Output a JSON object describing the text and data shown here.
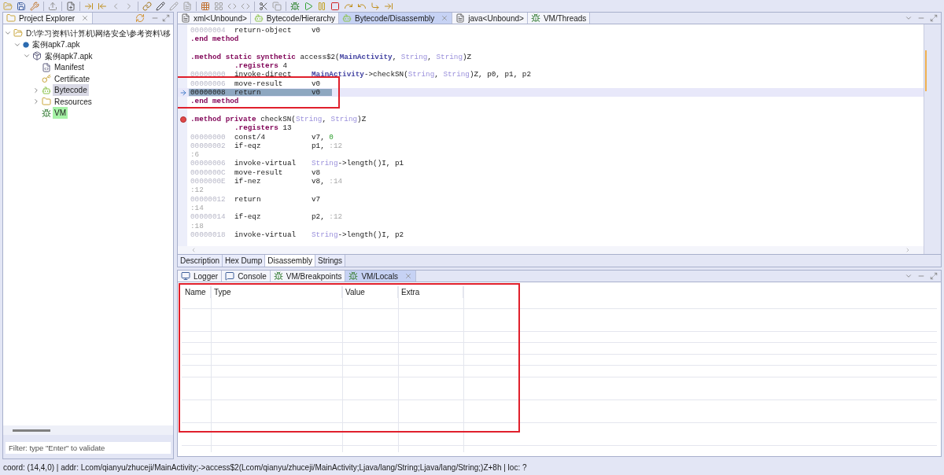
{
  "explorer": {
    "title": "Project Explorer",
    "tree": [
      {
        "kind": "folder",
        "label": "D:\\学习资料\\计算机\\网络安全\\参考资料\\移",
        "expanded": true,
        "selected": false,
        "highlighted": false,
        "children": [
          {
            "kind": "apk",
            "label": "案例apk7.apk",
            "expanded": true,
            "selected": false,
            "highlighted": false,
            "children": [
              {
                "kind": "package",
                "label": "案例apk7.apk",
                "expanded": true,
                "selected": false,
                "highlighted": false,
                "children": [
                  {
                    "kind": "manifest",
                    "label": "Manifest",
                    "selected": false,
                    "highlighted": false
                  },
                  {
                    "kind": "certificate",
                    "label": "Certificate",
                    "selected": false,
                    "highlighted": false
                  },
                  {
                    "kind": "bytecode",
                    "label": "Bytecode",
                    "expanded": false,
                    "selected": true,
                    "highlighted": false
                  },
                  {
                    "kind": "resources",
                    "label": "Resources",
                    "expanded": false,
                    "selected": false,
                    "highlighted": false
                  },
                  {
                    "kind": "vm",
                    "label": "VM",
                    "selected": false,
                    "highlighted": true
                  }
                ]
              }
            ]
          }
        ]
      }
    ],
    "filter": {
      "placeholder": "Filter: type \"Enter\" to validate"
    }
  },
  "editor": {
    "tabs": [
      {
        "kind": "xml",
        "label": "xml<Unbound>",
        "selected": false,
        "closable": false
      },
      {
        "kind": "bytecode",
        "label": "Bytecode/Hierarchy",
        "selected": false,
        "closable": false
      },
      {
        "kind": "bytecode",
        "label": "Bytecode/Disassembly",
        "selected": true,
        "closable": true
      },
      {
        "kind": "java",
        "label": "java<Unbound>",
        "selected": false,
        "closable": false
      },
      {
        "kind": "vm",
        "label": "VM/Threads",
        "selected": false,
        "closable": false
      }
    ],
    "lines": [
      {
        "kind": "instruction",
        "address": "00000004",
        "opcode": "return-object",
        "operands": [
          {
            "text": "v0",
            "kind": "plain"
          }
        ],
        "current": false,
        "breakpoint": false,
        "boxed": false
      },
      {
        "kind": "method",
        "segments": [
          {
            "text": ".end method",
            "kind": "keyword"
          }
        ],
        "current": false,
        "breakpoint": false,
        "boxed": false
      },
      {
        "kind": "blank",
        "current": false,
        "breakpoint": false,
        "boxed": false
      },
      {
        "kind": "method",
        "segments": [
          {
            "text": ".method static synthetic ",
            "kind": "keyword"
          },
          {
            "text": "access$2(",
            "kind": "plain"
          },
          {
            "text": "MainActivity",
            "kind": "class"
          },
          {
            "text": ", ",
            "kind": "plain"
          },
          {
            "text": "String",
            "kind": "type"
          },
          {
            "text": ", ",
            "kind": "plain"
          },
          {
            "text": "String",
            "kind": "type"
          },
          {
            "text": ")Z",
            "kind": "plain"
          }
        ],
        "current": false,
        "breakpoint": false,
        "boxed": false
      },
      {
        "kind": "directive",
        "segments": [
          {
            "text": ".registers ",
            "kind": "keyword"
          },
          {
            "text": "4",
            "kind": "plain"
          }
        ],
        "current": false,
        "breakpoint": false,
        "boxed": false
      },
      {
        "kind": "instruction",
        "address": "00000000",
        "opcode": "invoke-direct",
        "operands": [
          {
            "text": "MainActivity",
            "kind": "class"
          },
          {
            "text": "->checkSN(",
            "kind": "plain"
          },
          {
            "text": "String",
            "kind": "type"
          },
          {
            "text": ", ",
            "kind": "plain"
          },
          {
            "text": "String",
            "kind": "type"
          },
          {
            "text": ")Z, p0, p1, p2",
            "kind": "plain"
          }
        ],
        "current": false,
        "breakpoint": false,
        "boxed": false
      },
      {
        "kind": "instruction",
        "address": "00000006",
        "opcode": "move-result",
        "operands": [
          {
            "text": "v0",
            "kind": "plain"
          }
        ],
        "current": false,
        "breakpoint": false,
        "boxed": true
      },
      {
        "kind": "instruction",
        "address": "00000008",
        "opcode": "return",
        "operands": [
          {
            "text": "v0",
            "kind": "plain"
          }
        ],
        "current": true,
        "breakpoint": false,
        "boxed": true
      },
      {
        "kind": "method",
        "segments": [
          {
            "text": ".end method",
            "kind": "keyword"
          }
        ],
        "current": false,
        "breakpoint": false,
        "boxed": true
      },
      {
        "kind": "blank",
        "current": false,
        "breakpoint": false,
        "boxed": false
      },
      {
        "kind": "method",
        "segments": [
          {
            "text": ".method private ",
            "kind": "keyword"
          },
          {
            "text": "checkSN(",
            "kind": "plain"
          },
          {
            "text": "String",
            "kind": "type"
          },
          {
            "text": ", ",
            "kind": "plain"
          },
          {
            "text": "String",
            "kind": "type"
          },
          {
            "text": ")Z",
            "kind": "plain"
          }
        ],
        "current": false,
        "breakpoint": true,
        "boxed": false
      },
      {
        "kind": "directive",
        "segments": [
          {
            "text": ".registers ",
            "kind": "keyword"
          },
          {
            "text": "13",
            "kind": "plain"
          }
        ],
        "current": false,
        "breakpoint": false,
        "boxed": false
      },
      {
        "kind": "instruction",
        "address": "00000000",
        "opcode": "const/4",
        "operands": [
          {
            "text": "v7, ",
            "kind": "plain"
          },
          {
            "text": "0",
            "kind": "number"
          }
        ],
        "current": false,
        "breakpoint": false,
        "boxed": false
      },
      {
        "kind": "instruction",
        "address": "00000002",
        "opcode": "if-eqz",
        "operands": [
          {
            "text": "p1, ",
            "kind": "plain"
          },
          {
            "text": ":12",
            "kind": "label"
          }
        ],
        "current": false,
        "breakpoint": false,
        "boxed": false
      },
      {
        "kind": "label",
        "segments": [
          {
            "text": ":6",
            "kind": "label"
          }
        ],
        "current": false,
        "breakpoint": false,
        "boxed": false
      },
      {
        "kind": "instruction",
        "address": "00000006",
        "opcode": "invoke-virtual",
        "operands": [
          {
            "text": "String",
            "kind": "type"
          },
          {
            "text": "->length()I, p1",
            "kind": "plain"
          }
        ],
        "current": false,
        "breakpoint": false,
        "boxed": false
      },
      {
        "kind": "instruction",
        "address": "0000000C",
        "opcode": "move-result",
        "operands": [
          {
            "text": "v8",
            "kind": "plain"
          }
        ],
        "current": false,
        "breakpoint": false,
        "boxed": false
      },
      {
        "kind": "instruction",
        "address": "0000000E",
        "opcode": "if-nez",
        "operands": [
          {
            "text": "v8, ",
            "kind": "plain"
          },
          {
            "text": ":14",
            "kind": "label"
          }
        ],
        "current": false,
        "breakpoint": false,
        "boxed": false
      },
      {
        "kind": "label",
        "segments": [
          {
            "text": ":12",
            "kind": "label"
          }
        ],
        "current": false,
        "breakpoint": false,
        "boxed": false
      },
      {
        "kind": "instruction",
        "address": "00000012",
        "opcode": "return",
        "operands": [
          {
            "text": "v7",
            "kind": "plain"
          }
        ],
        "current": false,
        "breakpoint": false,
        "boxed": false
      },
      {
        "kind": "label",
        "segments": [
          {
            "text": ":14",
            "kind": "label"
          }
        ],
        "current": false,
        "breakpoint": false,
        "boxed": false
      },
      {
        "kind": "instruction",
        "address": "00000014",
        "opcode": "if-eqz",
        "operands": [
          {
            "text": "p2, ",
            "kind": "plain"
          },
          {
            "text": ":12",
            "kind": "label"
          }
        ],
        "current": false,
        "breakpoint": false,
        "boxed": false
      },
      {
        "kind": "label",
        "segments": [
          {
            "text": ":18",
            "kind": "label"
          }
        ],
        "current": false,
        "breakpoint": false,
        "boxed": false
      },
      {
        "kind": "instruction",
        "address": "00000018",
        "opcode": "invoke-virtual",
        "operands": [
          {
            "text": "String",
            "kind": "type"
          },
          {
            "text": "->length()I, p2",
            "kind": "plain"
          }
        ],
        "current": false,
        "breakpoint": false,
        "boxed": false
      }
    ],
    "bottom_tabs": [
      {
        "label": "Description",
        "selected": false
      },
      {
        "label": "Hex Dump",
        "selected": false
      },
      {
        "label": "Disassembly",
        "selected": true
      },
      {
        "label": "Strings",
        "selected": false
      }
    ]
  },
  "lower": {
    "tabs": [
      {
        "kind": "logger",
        "label": "Logger",
        "selected": false,
        "closable": false
      },
      {
        "kind": "console",
        "label": "Console",
        "selected": false,
        "closable": false
      },
      {
        "kind": "vm",
        "label": "VM/Breakpoints",
        "selected": false,
        "closable": false
      },
      {
        "kind": "vm",
        "label": "VM/Locals",
        "selected": true,
        "closable": true
      }
    ],
    "table": {
      "columns": [
        "Name",
        "Type",
        "Value",
        "Extra"
      ],
      "boxed": true
    }
  },
  "status_bar": "coord: (14,4,0) | addr: Lcom/qianyu/zhuceji/MainActivity;->access$2(Lcom/qianyu/zhuceji/MainActivity;Ljava/lang/String;Ljava/lang/String;)Z+8h | loc: ?"
}
